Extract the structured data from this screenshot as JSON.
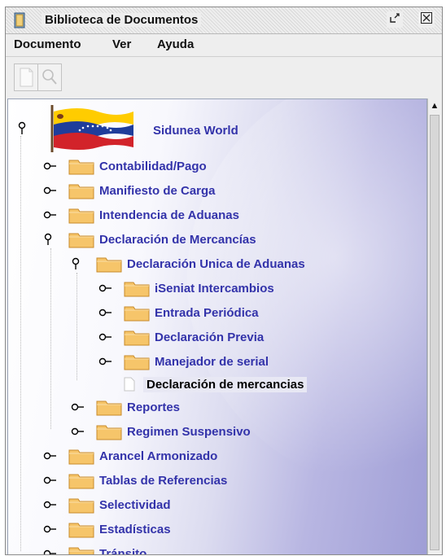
{
  "window": {
    "title": "Biblioteca de Documentos"
  },
  "menu": {
    "items": [
      "Documento",
      "Ver",
      "Ayuda"
    ]
  },
  "tree": {
    "root": "Sidunea World",
    "nodes": [
      "Contabilidad/Pago",
      "Manifiesto de Carga",
      "Intendencia de Aduanas",
      "Declaración de Mercancías",
      "Declaración Unica de Aduanas",
      "iSeniat Intercambios",
      "Entrada Periódica",
      "Declaración Previa",
      "Manejador de serial",
      "Declaración de mercancias",
      "Reportes",
      "Regimen Suspensivo",
      "Arancel Armonizado",
      "Tablas de Referencias",
      "Selectividad",
      "Estadísticas",
      "Tránsito"
    ],
    "selected": "Declaración de mercancias"
  },
  "colors": {
    "tree_text": "#3333aa",
    "folder": "#f6c56a",
    "flag_yellow": "#ffcc00",
    "flag_blue": "#1f3d9b",
    "flag_red": "#d2232a"
  }
}
